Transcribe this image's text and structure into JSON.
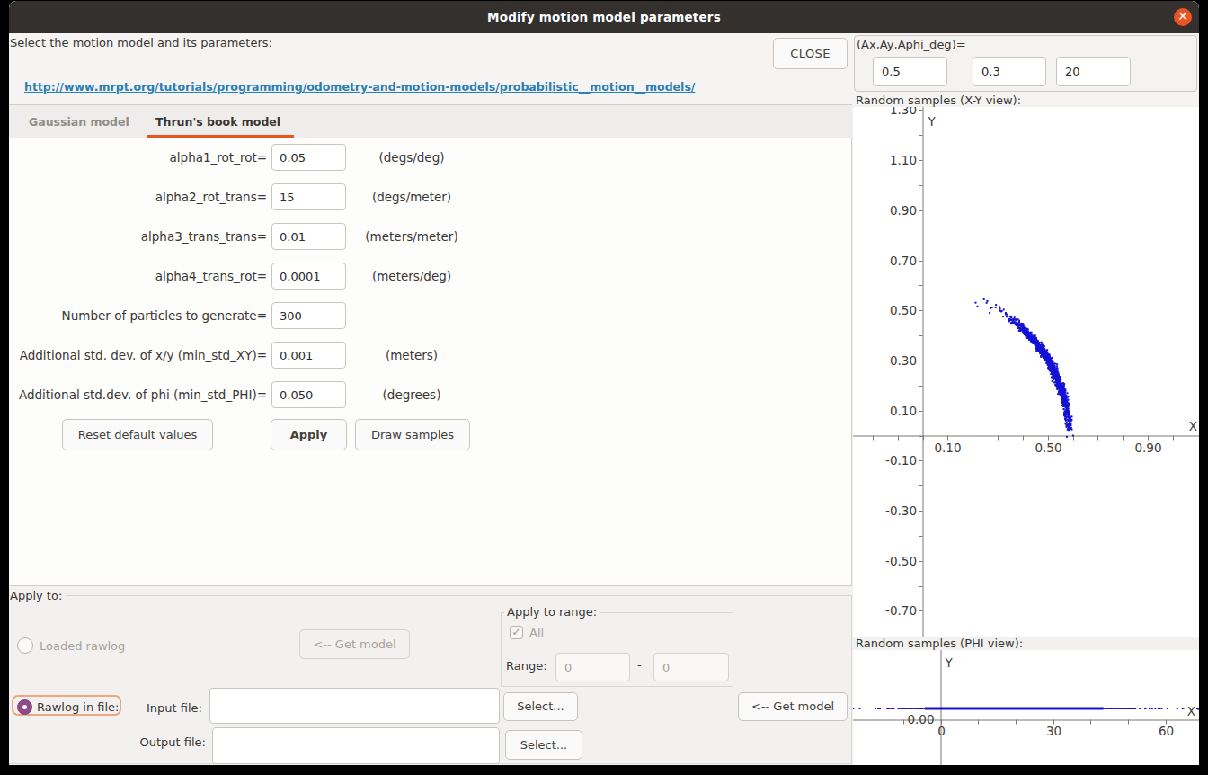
{
  "window": {
    "title": "Modify motion model parameters",
    "close_glyph": "✕"
  },
  "colors": {
    "accent_orange": "#e95420",
    "titlebar": "#33302d",
    "link_blue": "#2a80b2",
    "radio_purple": "#8d4a8d",
    "plot_blue": "#1412d4",
    "dialog_bg": "#f3f1ef"
  },
  "header": {
    "prompt": "Select the motion model and its parameters:",
    "close_button": "CLOSE",
    "link": "http://www.mrpt.org/tutorials/programming/odometry-and-motion-models/probabilistic__motion__models/"
  },
  "tabs": [
    {
      "label": "Gaussian model",
      "active": false
    },
    {
      "label": "Thrun's book model",
      "active": true
    }
  ],
  "form": {
    "rows": [
      {
        "label": "alpha1_rot_rot=",
        "value": "0.05",
        "unit": "(degs/deg)"
      },
      {
        "label": "alpha2_rot_trans=",
        "value": "15",
        "unit": "(degs/meter)"
      },
      {
        "label": "alpha3_trans_trans=",
        "value": "0.01",
        "unit": "(meters/meter)"
      },
      {
        "label": "alpha4_trans_rot=",
        "value": "0.0001",
        "unit": "(meters/deg)"
      },
      {
        "label": "Number of particles to generate=",
        "value": "300",
        "unit": ""
      },
      {
        "label": "Additional std. dev. of x/y (min_std_XY)=",
        "value": "0.001",
        "unit": "(meters)"
      },
      {
        "label": "Additional std.dev. of phi (min_std_PHI)=",
        "value": "0.050",
        "unit": "(degrees)"
      }
    ],
    "buttons": {
      "reset": "Reset default values",
      "apply": "Apply",
      "draw": "Draw samples"
    }
  },
  "apply_to": {
    "legend": "Apply to:",
    "loaded_rawlog_label": "Loaded rawlog",
    "get_model_top": "<-- Get model",
    "range_group": {
      "legend": "Apply to range:",
      "all_label": "All",
      "all_checked": true,
      "check_glyph": "✓",
      "range_label": "Range:",
      "from_value": "0",
      "dash": "-",
      "to_value": "0"
    },
    "rawlog_in_file_label": "Rawlog in file:",
    "input_file_label": "Input file:",
    "input_file_value": "",
    "select_input": "Select...",
    "get_model": "<-- Get model",
    "output_file_label": "Output file:",
    "output_file_value": "",
    "select_output": "Select..."
  },
  "right_panel": {
    "delta_label": "(Ax,Ay,Aphi_deg)=",
    "ax_value": "0.5",
    "ay_value": "0.3",
    "aphi_value": "20"
  },
  "chart_data": [
    {
      "type": "scatter",
      "title": "Random samples (X-Y view):",
      "xlabel": "X",
      "ylabel": "Y",
      "x_range": [
        -0.278,
        1.103
      ],
      "y_range": [
        -0.802,
        1.312
      ],
      "tick_step": 0.1,
      "x_labeled_ticks": [
        "0.10",
        "0.50",
        "0.90"
      ],
      "y_labeled_ticks": [
        "1.30",
        "1.10",
        "0.90",
        "0.70",
        "0.50",
        "0.30",
        "0.10",
        "-0.10",
        "-0.30",
        "-0.50",
        "-0.70"
      ],
      "grid": false,
      "legend": "none",
      "point_color": "#1412d4",
      "n_points": 1400,
      "distribution": {
        "kind": "banana-arc",
        "odometry_mean_xy": [
          0.5,
          0.3
        ],
        "radius_mean": 0.585,
        "radius_sd": 0.007,
        "angle_mean_deg": 29,
        "angle_sd_deg": 12.3
      }
    },
    {
      "type": "scatter",
      "title": "Random samples (PHI view):",
      "xlabel": "X",
      "ylabel": "Y",
      "x_range": [
        -23.4,
        68.9
      ],
      "y_zero_tick": "0.00",
      "x_labeled_ticks": [
        "0",
        "30",
        "60"
      ],
      "minor_tick_step": 10,
      "grid": false,
      "legend": "none",
      "point_color": "#1412d4",
      "n_points": 700,
      "dense_band_deg": [
        -4.2,
        43.5
      ],
      "distribution": {
        "kind": "normal",
        "mean_deg": 23,
        "sd_deg": 13.5
      }
    }
  ]
}
